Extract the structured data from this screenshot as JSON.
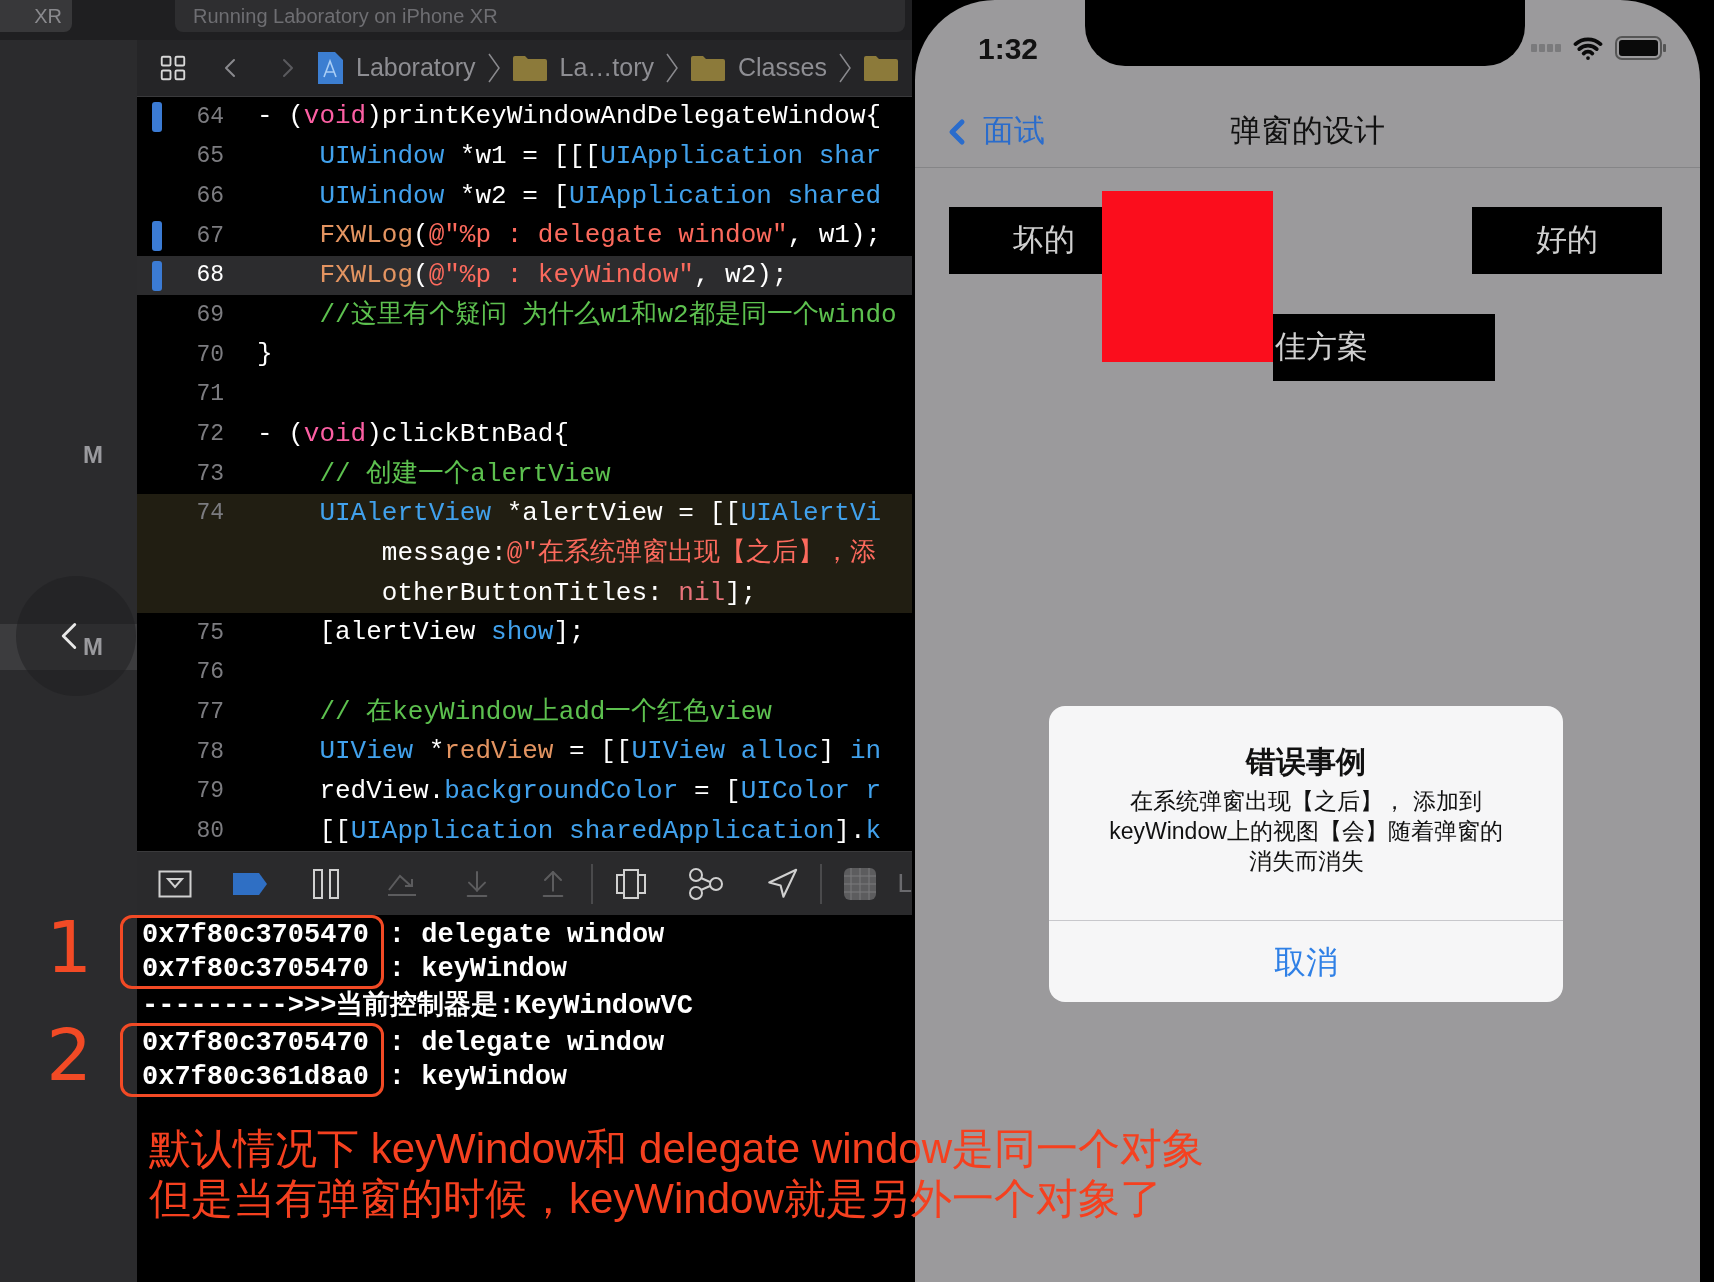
{
  "top_bar": {
    "tab": "XR",
    "status": "Running Laboratory on iPhone XR"
  },
  "sidebar": {
    "items": [
      {
        "label": "M",
        "selected": false
      },
      {
        "label": "M",
        "selected": true
      }
    ]
  },
  "jump_bar": {
    "items": [
      {
        "kind": "project",
        "label": "Laboratory"
      },
      {
        "kind": "folder",
        "label": "La…tory"
      },
      {
        "kind": "folder",
        "label": "Classes"
      },
      {
        "kind": "folder"
      }
    ]
  },
  "code": {
    "lines": [
      {
        "number": "64",
        "current": false,
        "highlighted": false,
        "changed": true,
        "tokens": [
          {
            "text": "- (",
            "kind": "plain"
          },
          {
            "text": "void",
            "kind": "keyword"
          },
          {
            "text": ")printKeyWindowAndDelegateWindow{",
            "kind": "plain"
          }
        ]
      },
      {
        "number": "65",
        "current": false,
        "highlighted": false,
        "changed": false,
        "tokens": [
          {
            "text": "    UIWindow",
            "kind": "type"
          },
          {
            "text": " *w1 = [[[",
            "kind": "plain"
          },
          {
            "text": "UIApplication",
            "kind": "type"
          },
          {
            "text": " shar",
            "kind": "type"
          }
        ]
      },
      {
        "number": "66",
        "current": false,
        "highlighted": false,
        "changed": false,
        "tokens": [
          {
            "text": "    UIWindow",
            "kind": "type"
          },
          {
            "text": " *w2 = [",
            "kind": "plain"
          },
          {
            "text": "UIApplication",
            "kind": "type"
          },
          {
            "text": " shared",
            "kind": "type"
          }
        ]
      },
      {
        "number": "67",
        "current": false,
        "highlighted": false,
        "changed": true,
        "tokens": [
          {
            "text": "    FXWLog",
            "kind": "func"
          },
          {
            "text": "(",
            "kind": "plain"
          },
          {
            "text": "@\"%p : delegate window\"",
            "kind": "string"
          },
          {
            "text": ", w1);",
            "kind": "plain"
          }
        ]
      },
      {
        "number": "68",
        "current": true,
        "highlighted": false,
        "changed": true,
        "tokens": [
          {
            "text": "    FXWLog",
            "kind": "func"
          },
          {
            "text": "(",
            "kind": "plain"
          },
          {
            "text": "@\"%p : keyWindow\"",
            "kind": "string"
          },
          {
            "text": ", w2);",
            "kind": "plain"
          }
        ]
      },
      {
        "number": "69",
        "current": false,
        "highlighted": false,
        "changed": false,
        "tokens": [
          {
            "text": "    //这里有个疑问 为什么w1和w2都是同一个windo",
            "kind": "comment"
          }
        ]
      },
      {
        "number": "70",
        "current": false,
        "highlighted": false,
        "changed": false,
        "tokens": [
          {
            "text": "}",
            "kind": "plain"
          }
        ]
      },
      {
        "number": "71",
        "current": false,
        "highlighted": false,
        "changed": false
      },
      {
        "number": "72",
        "current": false,
        "highlighted": false,
        "changed": false,
        "tokens": [
          {
            "text": "- (",
            "kind": "plain"
          },
          {
            "text": "void",
            "kind": "keyword"
          },
          {
            "text": ")clickBtnBad{",
            "kind": "plain"
          }
        ]
      },
      {
        "number": "73",
        "current": false,
        "highlighted": false,
        "changed": false,
        "tokens": [
          {
            "text": "    // 创建一个alertView",
            "kind": "comment"
          }
        ]
      },
      {
        "number": "74",
        "current": false,
        "highlighted": true,
        "changed": false,
        "tokens": [
          {
            "text": "    UIAlertView",
            "kind": "type"
          },
          {
            "text": " *alertView = [[",
            "kind": "plain"
          },
          {
            "text": "UIAlertVi",
            "kind": "type"
          }
        ]
      },
      {
        "current": false,
        "highlighted": true,
        "changed": false,
        "tokens": [
          {
            "text": "        message:",
            "kind": "plain"
          },
          {
            "text": "@\"在系统弹窗出现【之后】，添",
            "kind": "string"
          }
        ]
      },
      {
        "current": false,
        "highlighted": true,
        "changed": false,
        "tokens": [
          {
            "text": "        otherButtonTitles: ",
            "kind": "plain"
          },
          {
            "text": "nil",
            "kind": "literal"
          },
          {
            "text": "];",
            "kind": "plain"
          }
        ]
      },
      {
        "number": "75",
        "current": false,
        "highlighted": false,
        "changed": false,
        "tokens": [
          {
            "text": "    [alertView ",
            "kind": "plain"
          },
          {
            "text": "show",
            "kind": "type"
          },
          {
            "text": "];",
            "kind": "plain"
          }
        ]
      },
      {
        "number": "76",
        "current": false,
        "highlighted": false,
        "changed": false
      },
      {
        "number": "77",
        "current": false,
        "highlighted": false,
        "changed": false,
        "tokens": [
          {
            "text": "    // 在keyWindow上add一个红色view",
            "kind": "comment"
          }
        ]
      },
      {
        "number": "78",
        "current": false,
        "highlighted": false,
        "changed": false,
        "tokens": [
          {
            "text": "    UIView",
            "kind": "type"
          },
          {
            "text": " *",
            "kind": "plain"
          },
          {
            "text": "redView",
            "kind": "func"
          },
          {
            "text": " = [[",
            "kind": "plain"
          },
          {
            "text": "UIView",
            "kind": "type"
          },
          {
            "text": " alloc",
            "kind": "type"
          },
          {
            "text": "] ",
            "kind": "plain"
          },
          {
            "text": "in",
            "kind": "type"
          }
        ]
      },
      {
        "number": "79",
        "current": false,
        "highlighted": false,
        "changed": false,
        "tokens": [
          {
            "text": "    redView.",
            "kind": "plain"
          },
          {
            "text": "backgroundColor",
            "kind": "type"
          },
          {
            "text": " = [",
            "kind": "plain"
          },
          {
            "text": "UIColor",
            "kind": "type"
          },
          {
            "text": " r",
            "kind": "type"
          }
        ]
      },
      {
        "number": "80",
        "current": false,
        "highlighted": false,
        "changed": false,
        "tokens": [
          {
            "text": "    [[",
            "kind": "plain"
          },
          {
            "text": "UIApplication",
            "kind": "type"
          },
          {
            "text": " sharedApplication",
            "kind": "type"
          },
          {
            "text": "].",
            "kind": "plain"
          },
          {
            "text": "k",
            "kind": "type"
          }
        ]
      }
    ]
  },
  "debug_bar": {
    "buttons": [
      {
        "kind": "console",
        "active": false,
        "disabled": false
      },
      {
        "kind": "breakpoints",
        "active": true,
        "disabled": false
      },
      {
        "kind": "pause",
        "active": false,
        "disabled": false
      },
      {
        "kind": "step_over",
        "active": false,
        "disabled": true
      },
      {
        "kind": "step_in",
        "active": false,
        "disabled": true
      },
      {
        "kind": "step_out",
        "active": false,
        "disabled": true
      },
      {
        "kind": "view_debugger",
        "active": false,
        "disabled": false
      },
      {
        "kind": "memory_graph",
        "active": false,
        "disabled": false
      },
      {
        "kind": "location",
        "active": false,
        "disabled": false
      },
      {
        "kind": "simulator",
        "active": false,
        "disabled": true
      }
    ],
    "label": "L"
  },
  "console": {
    "groups": [
      {
        "marker": "1",
        "boxed": true,
        "lines": [
          {
            "address": "0x7f80c3705470",
            "message": ": delegate window"
          },
          {
            "address": "0x7f80c3705470",
            "message": ": keyWindow"
          }
        ]
      },
      {
        "boxed": false,
        "lines": [
          {
            "message": "--------->>>当前控制器是:KeyWindowVC"
          }
        ]
      },
      {
        "marker": "2",
        "boxed": true,
        "lines": [
          {
            "address": "0x7f80c3705470",
            "message": ": delegate window"
          },
          {
            "address": "0x7f80c361d8a0",
            "message": ": keyWindow"
          }
        ]
      }
    ]
  },
  "annotation": {
    "lines": [
      "默认情况下 keyWindow和 delegate window是同一个对象",
      "但是当有弹窗的时候，keyWindow就是另外一个对象了"
    ]
  },
  "simulator": {
    "status_bar": {
      "time": "1:32"
    },
    "nav_bar": {
      "back": "面试",
      "title": "弹窗的设计"
    },
    "buttons": [
      {
        "label": "坏的"
      },
      {
        "label": "好的"
      },
      {
        "label": "佳方案"
      }
    ],
    "alert": {
      "title": "错误事例",
      "message_lines": [
        "在系统弹窗出现【之后】， 添加到",
        "keyWindow上的视图【会】随着弹窗的",
        "消失而消失"
      ],
      "button": "取消"
    }
  }
}
